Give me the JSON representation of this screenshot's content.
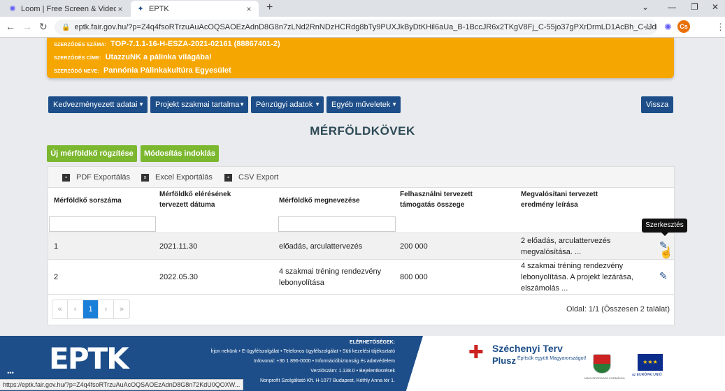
{
  "browser": {
    "tabs": [
      {
        "label": "Loom | Free Screen & Video Reco",
        "icon": "loom-icon"
      },
      {
        "label": "EPTK",
        "icon": "eptk-icon"
      }
    ],
    "new_tab": "+",
    "url": "eptk.fair.gov.hu/?p=Z4q4fsoRTrzuAuAcOQSAOEzAdnD8G8n7zLNd2RnNDzHCRdg8bTy9PUXJkByDtKHil6aUa_B-1BccJR6x2TKgV8Fj_C-55jo37gPXrDrmLD1AcBh_C-IJdLA9x...",
    "avatar": "Cs"
  },
  "contract": {
    "number_label": "SZERZŐDÉS SZÁMA:",
    "number": "TOP-7.1.1-16-H-ESZA-2021-02161 (88867401-2)",
    "title_label": "SZERZŐDÉS CÍME:",
    "title": "UtazzuNK a pálinka világába!",
    "party_label": "SZERZŐDŐ NEVE:",
    "party": "Pannónia Pálinkakultúra Egyesület"
  },
  "menu": {
    "items": [
      "Kedvezményezett adatai",
      "Projekt szakmai tartalma",
      "Pénzügyi adatok",
      "Egyéb műveletek"
    ],
    "back": "Vissza"
  },
  "page": {
    "title": "MÉRFÖLDKÖVEK",
    "new_button": "Új mérföldkő rögzítése",
    "justify_button": "Módosítás indoklás"
  },
  "export": {
    "pdf": "PDF Exportálás",
    "excel": "Excel Exportálás",
    "csv": "CSV Export"
  },
  "table": {
    "headers": [
      "Mérföldkő sorszáma",
      "Mérföldkő elérésének tervezett dátuma",
      "Mérföldkő megnevezése",
      "Felhasználni tervezett támogatás összege",
      "Megvalósítani tervezett eredmény leírása"
    ],
    "rows": [
      {
        "no": "1",
        "date": "2021.11.30",
        "name": "előadás, arculattervezés",
        "amount": "200 000",
        "desc": "2 előadás, arculattervezés megvalósítása. ..."
      },
      {
        "no": "2",
        "date": "2022.05.30",
        "name": "4 szakmai tréning rendezvény lebonyolítása",
        "amount": "800 000",
        "desc": "4 szakmai tréning rendezvény lebonyolítása. A projekt lezárása, elszámolás ..."
      }
    ],
    "tooltip": "Szerkesztés"
  },
  "pagination": {
    "first": "«",
    "prev": "‹",
    "current": "1",
    "next": "›",
    "last": "»",
    "info": "Oldal: 1/1 (Összesen 2 találat)"
  },
  "footer": {
    "logo": "EPTK",
    "contact_title": "ELÉRHETŐSÉGEK:",
    "line1": "Írjon nekünk • E-ügyfélszolgálat • Telefonos ügyfélszolgálat • Süti kezelési tájékoztató",
    "line2": "Infovonal: +36 1 896-0000 • Információbiztonság és adatvédelem",
    "line3": "Verziószám: 1.138.0 • Bejelentkezések",
    "line4": "Nonprofit Szolgáltató Kft. H-1077 Budapest, Kéthly Anna tér 1.",
    "szechenyi_1": "Széchenyi Terv",
    "szechenyi_2": "Plusz",
    "szechenyi_slogan": "Építsük együtt Magyarországot!",
    "crest_label": "MAGYARORSZÁG KORMÁNYA",
    "eu_label": "az EURÓPAI UNIÓ"
  },
  "status_url": "https://eptk.fair.gov.hu/?p=Z4q4fsoRTrzuAuAcOQSAOEzAdnD8G8n72KdU0QOXW..."
}
